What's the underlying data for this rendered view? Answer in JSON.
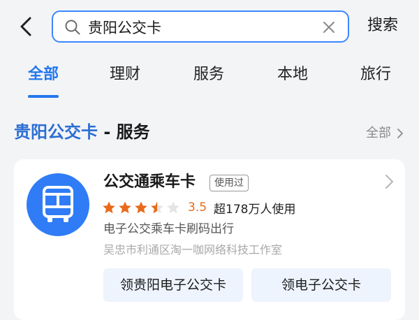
{
  "search": {
    "query": "贵阳公交卡",
    "button_label": "搜索"
  },
  "tabs": [
    {
      "label": "全部",
      "active": true
    },
    {
      "label": "理财",
      "active": false
    },
    {
      "label": "服务",
      "active": false
    },
    {
      "label": "本地",
      "active": false
    },
    {
      "label": "旅行",
      "active": false
    }
  ],
  "section": {
    "title_keyword": "贵阳公交卡",
    "title_rest": " - 服务",
    "more_label": "全部"
  },
  "result": {
    "name": "公交通乘车卡",
    "badge": "使用过",
    "rating": 3.5,
    "rating_text": "3.5",
    "users_text": "超178万人使用",
    "description": "电子公交乘车卡刷码出行",
    "developer": "吴忠市利通区淘一咖网络科技工作室",
    "actions": [
      {
        "label": "领贵阳电子公交卡"
      },
      {
        "label": "领电子公交卡"
      }
    ]
  },
  "colors": {
    "accent": "#2277ee",
    "icon_bg": "#2f7cf6",
    "star": "#e86a1a",
    "star_empty": "#e4e4e4"
  },
  "icons": {
    "back": "back-arrow-icon",
    "search": "search-icon",
    "clear": "close-icon",
    "app": "bus-icon",
    "chevron": "chevron-right-icon",
    "star": "star-icon"
  }
}
